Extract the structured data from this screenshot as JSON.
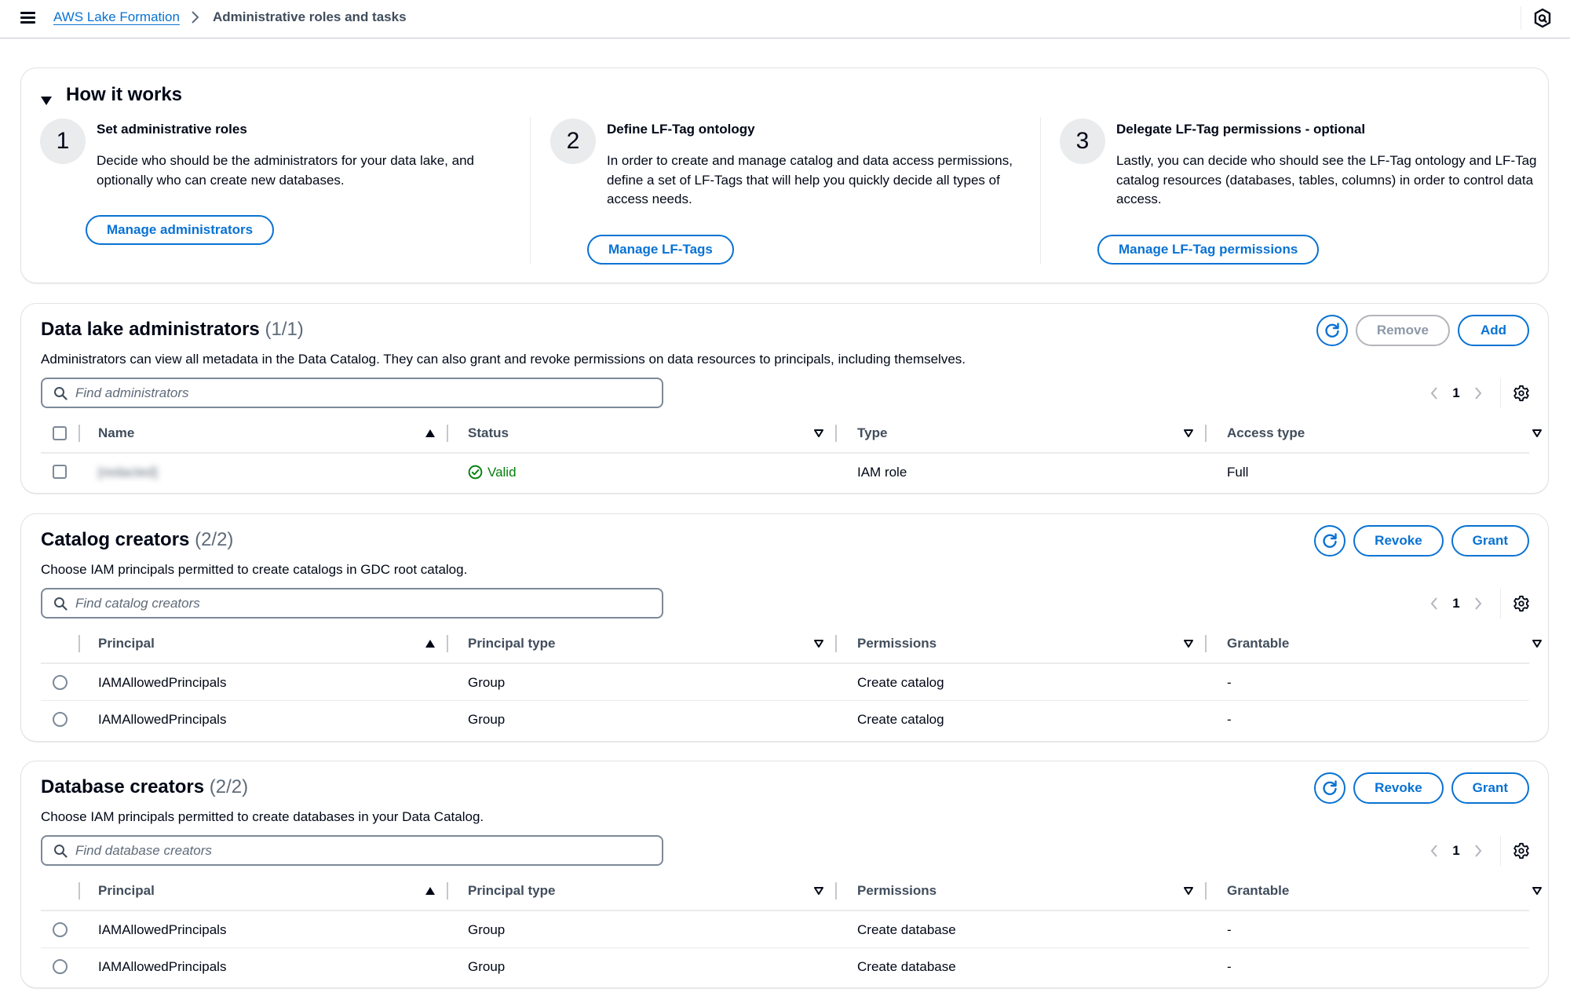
{
  "header": {
    "menu_icon": "hamburger-menu-icon",
    "breadcrumb": {
      "root": "AWS Lake Formation",
      "current": "Administrative roles and tasks"
    },
    "right_icon": "notifications-hexagon-icon"
  },
  "how_it_works": {
    "title": "How it works",
    "expanded": true,
    "steps": [
      {
        "number": "1",
        "title": "Set administrative roles",
        "description": "Decide who should be the administrators for your data lake, and optionally who can create new databases.",
        "button": "Manage administrators"
      },
      {
        "number": "2",
        "title": "Define LF-Tag ontology",
        "description": "In order to create and manage catalog and data access permissions, define a set of LF-Tags that will help you quickly decide all types of access needs.",
        "button": "Manage LF-Tags"
      },
      {
        "number": "3",
        "title": "Delegate LF-Tag permissions - optional",
        "description": "Lastly, you can decide who should see the LF-Tag ontology and LF-Tag catalog resources (databases, tables, columns) in order to control data access.",
        "button": "Manage LF-Tag permissions"
      }
    ]
  },
  "admins": {
    "title": "Data lake administrators",
    "count": "(1/1)",
    "description": "Administrators can view all metadata in the Data Catalog. They can also grant and revoke permissions on data resources to principals, including themselves.",
    "buttons": {
      "remove": "Remove",
      "add": "Add"
    },
    "search_placeholder": "Find administrators",
    "page": "1",
    "columns": [
      "Name",
      "Status",
      "Type",
      "Access type"
    ],
    "rows": [
      {
        "name": "[redacted]",
        "status": "Valid",
        "type": "IAM role",
        "access_type": "Full"
      }
    ]
  },
  "catalog_creators": {
    "title": "Catalog creators",
    "count": "(2/2)",
    "description": "Choose IAM principals permitted to create catalogs in GDC root catalog.",
    "buttons": {
      "revoke": "Revoke",
      "grant": "Grant"
    },
    "search_placeholder": "Find catalog creators",
    "page": "1",
    "columns": [
      "Principal",
      "Principal type",
      "Permissions",
      "Grantable"
    ],
    "rows": [
      {
        "principal": "IAMAllowedPrincipals",
        "type": "Group",
        "permissions": "Create catalog",
        "grantable": "-"
      },
      {
        "principal": "IAMAllowedPrincipals",
        "type": "Group",
        "permissions": "Create catalog",
        "grantable": "-"
      }
    ]
  },
  "database_creators": {
    "title": "Database creators",
    "count": "(2/2)",
    "description": "Choose IAM principals permitted to create databases in your Data Catalog.",
    "buttons": {
      "revoke": "Revoke",
      "grant": "Grant"
    },
    "search_placeholder": "Find database creators",
    "page": "1",
    "columns": [
      "Principal",
      "Principal type",
      "Permissions",
      "Grantable"
    ],
    "rows": [
      {
        "principal": "IAMAllowedPrincipals",
        "type": "Group",
        "permissions": "Create database",
        "grantable": "-"
      },
      {
        "principal": "IAMAllowedPrincipals",
        "type": "Group",
        "permissions": "Create database",
        "grantable": "-"
      }
    ]
  },
  "colors": {
    "accent": "#0972d3",
    "text": "#000716",
    "success": "#037f0c",
    "disabled": "#8d99a8"
  }
}
